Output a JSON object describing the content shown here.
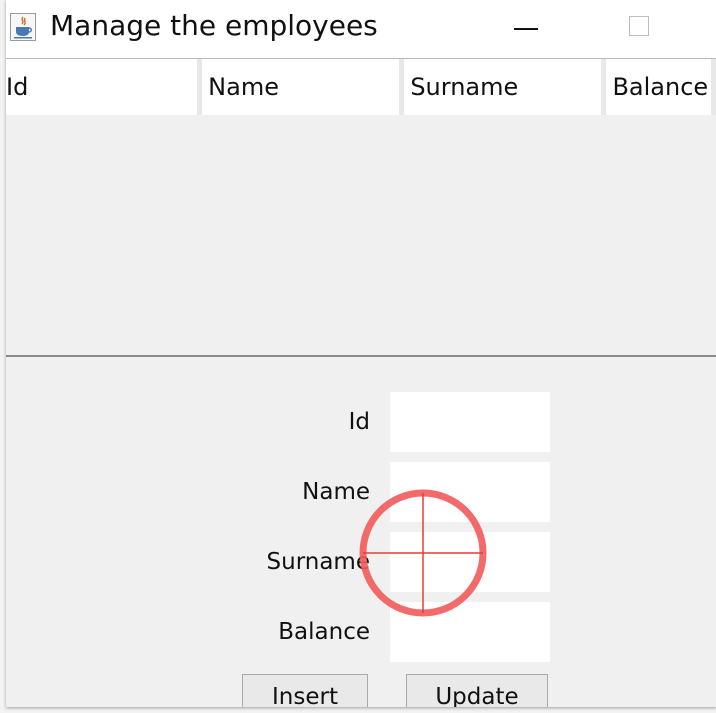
{
  "window": {
    "title": "Manage the employees",
    "app_icon": "java-icon",
    "controls": [
      "minimize-icon",
      "maximize-icon"
    ]
  },
  "table": {
    "columns": [
      "Id",
      "Name",
      "Surname",
      "Balance"
    ],
    "rows": []
  },
  "form": {
    "fields": [
      {
        "label": "Id",
        "value": ""
      },
      {
        "label": "Name",
        "value": ""
      },
      {
        "label": "Surname",
        "value": ""
      },
      {
        "label": "Balance",
        "value": ""
      }
    ],
    "buttons": {
      "insert": "Insert",
      "update": "Update"
    }
  },
  "cursor": {
    "icon": "crosshair-cursor-icon",
    "color": "#f25a5a"
  },
  "colors": {
    "titlebar": "#ffffff",
    "window_bg": "#f0f0f0",
    "header_cell": "#ffffff",
    "field_bg": "#ffffff",
    "button_bg": "#e9e9e9"
  }
}
